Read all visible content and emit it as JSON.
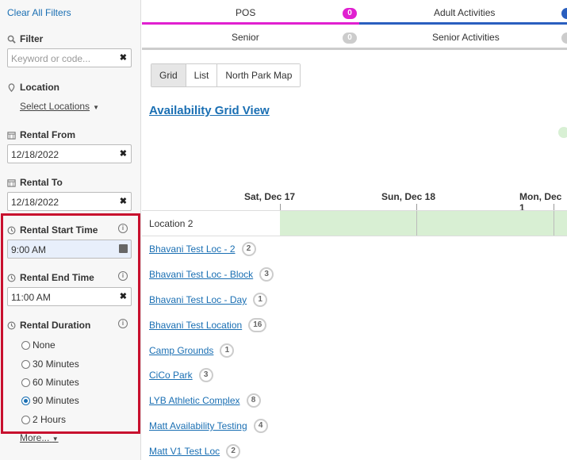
{
  "sidebar": {
    "clear_filters": "Clear All Filters",
    "filter_label": "Filter",
    "filter_placeholder": "Keyword or code...",
    "location_label": "Location",
    "select_locations": "Select Locations",
    "rental_from_label": "Rental From",
    "rental_from_value": "12/18/2022",
    "rental_to_label": "Rental To",
    "rental_to_value": "12/18/2022",
    "start_time_label": "Rental Start Time",
    "start_time_value": "9:00 AM",
    "end_time_label": "Rental End Time",
    "end_time_value": "11:00 AM",
    "duration_label": "Rental Duration",
    "duration_options": [
      "None",
      "30 Minutes",
      "60 Minutes",
      "90 Minutes",
      "2 Hours"
    ],
    "duration_selected": "90 Minutes",
    "more": "More..."
  },
  "tabs": {
    "row1": [
      {
        "label": "POS",
        "count": "0",
        "color": "#e020d0"
      },
      {
        "label": "Adult Activities",
        "color": "#2a5fbf"
      }
    ],
    "row2": [
      {
        "label": "Senior",
        "count": "0"
      },
      {
        "label": "Senior Activities"
      }
    ]
  },
  "main": {
    "view_buttons": [
      "Grid",
      "List",
      "North Park Map"
    ],
    "active_view": "Grid",
    "title": "Availability Grid View",
    "dates": [
      "Sat, Dec 17",
      "Sun, Dec 18",
      "Mon, Dec 1"
    ],
    "location_row": "Location 2",
    "locations": [
      {
        "name": "Bhavani Test Loc - 2",
        "count": "2"
      },
      {
        "name": "Bhavani Test Loc - Block",
        "count": "3"
      },
      {
        "name": "Bhavani Test Loc - Day",
        "count": "1"
      },
      {
        "name": "Bhavani Test Location",
        "count": "16"
      },
      {
        "name": "Camp Grounds",
        "count": "1"
      },
      {
        "name": "CiCo Park",
        "count": "3"
      },
      {
        "name": "LYB Athletic Complex",
        "count": "8"
      },
      {
        "name": "Matt Availability Testing",
        "count": "4"
      },
      {
        "name": "Matt V1 Test Loc",
        "count": "2"
      }
    ]
  },
  "colors": {
    "accent": "#1a6fb3",
    "highlight": "#c8102e",
    "available": "#d8efd3"
  }
}
